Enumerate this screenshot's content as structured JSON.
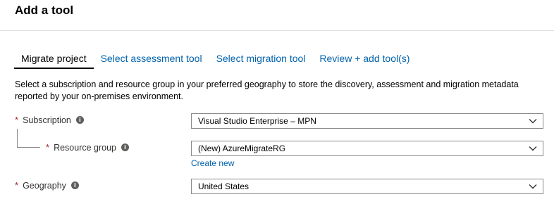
{
  "page": {
    "title": "Add a tool"
  },
  "tabs": [
    {
      "label": "Migrate project",
      "active": true
    },
    {
      "label": "Select assessment tool",
      "active": false
    },
    {
      "label": "Select migration tool",
      "active": false
    },
    {
      "label": "Review + add tool(s)",
      "active": false
    }
  ],
  "description": "Select a subscription and resource group in your preferred geography to store the discovery, assessment and migration metadata reported by your on-premises environment.",
  "form": {
    "required_marker": "*",
    "info_glyph": "i",
    "subscription": {
      "label": "Subscription",
      "value": "Visual Studio Enterprise – MPN"
    },
    "resource_group": {
      "label": "Resource group",
      "value": "(New) AzureMigrateRG",
      "create_link": "Create new"
    },
    "geography": {
      "label": "Geography",
      "value": "United States"
    }
  },
  "colors": {
    "link": "#0062ad",
    "required": "#a4262c",
    "border": "#8a8886"
  }
}
